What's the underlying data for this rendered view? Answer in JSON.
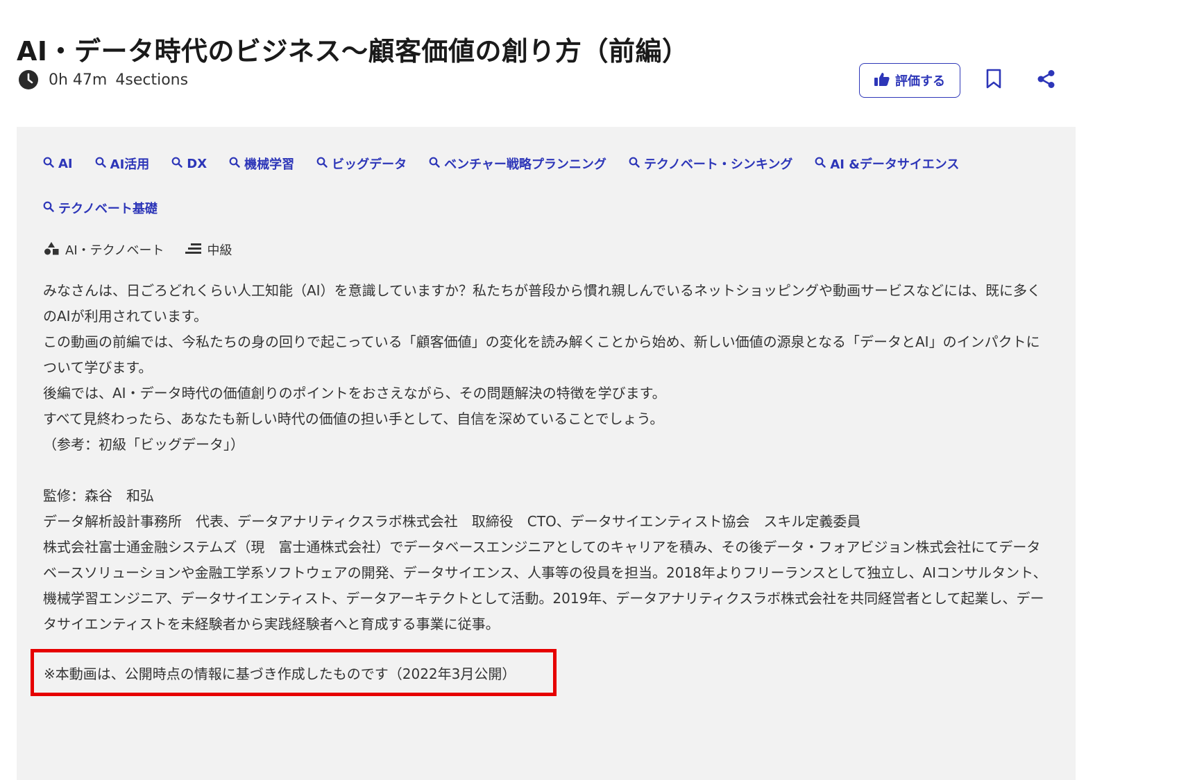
{
  "header": {
    "title": "AI・データ時代のビジネス〜顧客価値の創り方（前編）",
    "duration": "0h 47m",
    "sections": "4sections"
  },
  "actions": {
    "rate_label": "評価する",
    "icons": [
      "clock-icon",
      "thumbs-up-icon",
      "bookmark-icon",
      "share-icon",
      "search-icon",
      "shapes-icon",
      "level-icon"
    ]
  },
  "tags": [
    "AI",
    "AI活用",
    "DX",
    "機械学習",
    "ビッグデータ",
    "ベンチャー戦略プランニング",
    "テクノベート・シンキング",
    "AI &データサイエンス",
    "テクノベート基礎"
  ],
  "category": "AI・テクノベート",
  "level": "中級",
  "description": [
    "みなさんは、日ごろどれくらい人工知能（AI）を意識していますか？私たちが普段から慣れ親しんでいるネットショッピングや動画サービスなどには、既に多くのAIが利用されています。",
    "この動画の前編では、今私たちの身の回りで起こっている「顧客価値」の変化を読み解くことから始め、新しい価値の源泉となる「データとAI」のインパクトについて学びます。",
    "後編では、AI・データ時代の価値創りのポイントをおさえながら、その問題解決の特徴を学びます。",
    "すべて見終わったら、あなたも新しい時代の価値の担い手として、自信を深めていることでしょう。",
    "（参考：初級「ビッグデータ」）"
  ],
  "supervisor": [
    "監修：森谷　和弘",
    "データ解析設計事務所　代表、データアナリティクスラボ株式会社　取締役　CTO、データサイエンティスト協会　スキル定義委員",
    "株式会社富士通金融システムズ（現　富士通株式会社）でデータベースエンジニアとしてのキャリアを積み、その後データ・フォアビジョン株式会社にてデータベースソリューションや金融工学系ソフトウェアの開発、データサイエンス、人事等の役員を担当。2018年よりフリーランスとして独立し、AIコンサルタント、機械学習エンジニア、データサイエンティスト、データアーキテクトとして活動。2019年、データアナリティクスラボ株式会社を共同経営者として起業し、データサイエンティストを未経験者から実践経験者へと育成する事業に従事。"
  ],
  "notice": "※本動画は、公開時点の情報に基づき作成したものです（2022年3月公開）",
  "colors": {
    "accent": "#2d36b8",
    "panel_bg": "#f2f2f2",
    "highlight_border": "#e60000"
  }
}
